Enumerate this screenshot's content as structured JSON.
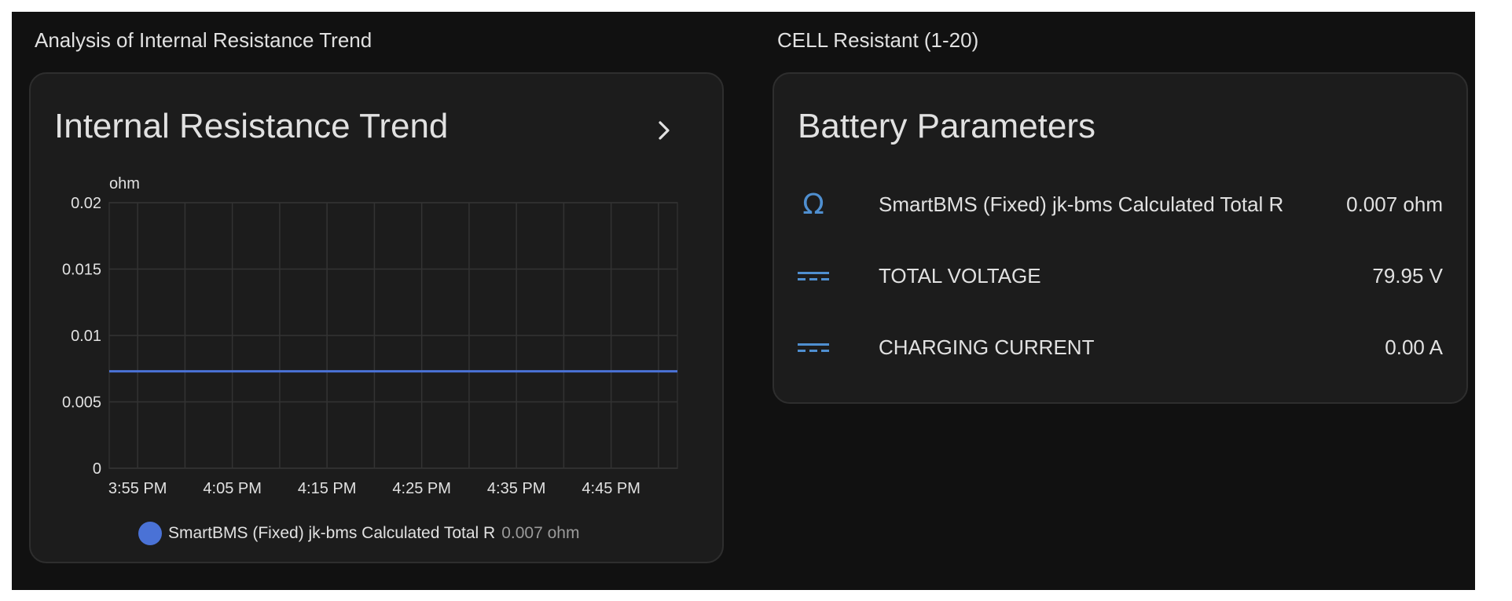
{
  "left_section": {
    "title": "Analysis of Internal Resistance Trend",
    "card_title": "Internal Resistance Trend"
  },
  "right_section": {
    "title": "CELL Resistant (1-20)",
    "card_title": "Battery Parameters",
    "rows": [
      {
        "icon": "omega-icon",
        "name": "SmartBMS (Fixed) jk-bms Calculated Total R",
        "value": "0.007 ohm"
      },
      {
        "icon": "dc-current-icon",
        "name": "TOTAL VOLTAGE",
        "value": "79.95 V"
      },
      {
        "icon": "dc-current-icon",
        "name": "CHARGING CURRENT",
        "value": "0.00 A"
      }
    ]
  },
  "colors": {
    "background": "#111111",
    "card": "#1c1c1c",
    "series": "#4a72d6",
    "icon": "#4f8fd0"
  },
  "chart_data": {
    "type": "line",
    "unit_label": "ohm",
    "x_ticks": [
      "3:55 PM",
      "4:05 PM",
      "4:15 PM",
      "4:25 PM",
      "4:35 PM",
      "4:45 PM"
    ],
    "y_ticks": [
      "0.02",
      "0.015",
      "0.01",
      "0.005",
      "0"
    ],
    "ylim": [
      0,
      0.02
    ],
    "grid": true,
    "legend_position": "bottom",
    "series": [
      {
        "name": "SmartBMS (Fixed) jk-bms Calculated Total R",
        "legend_value": "0.007 ohm",
        "x": [
          "3:52 PM",
          "4:52 PM"
        ],
        "values": [
          0.0073,
          0.0073
        ]
      }
    ]
  }
}
